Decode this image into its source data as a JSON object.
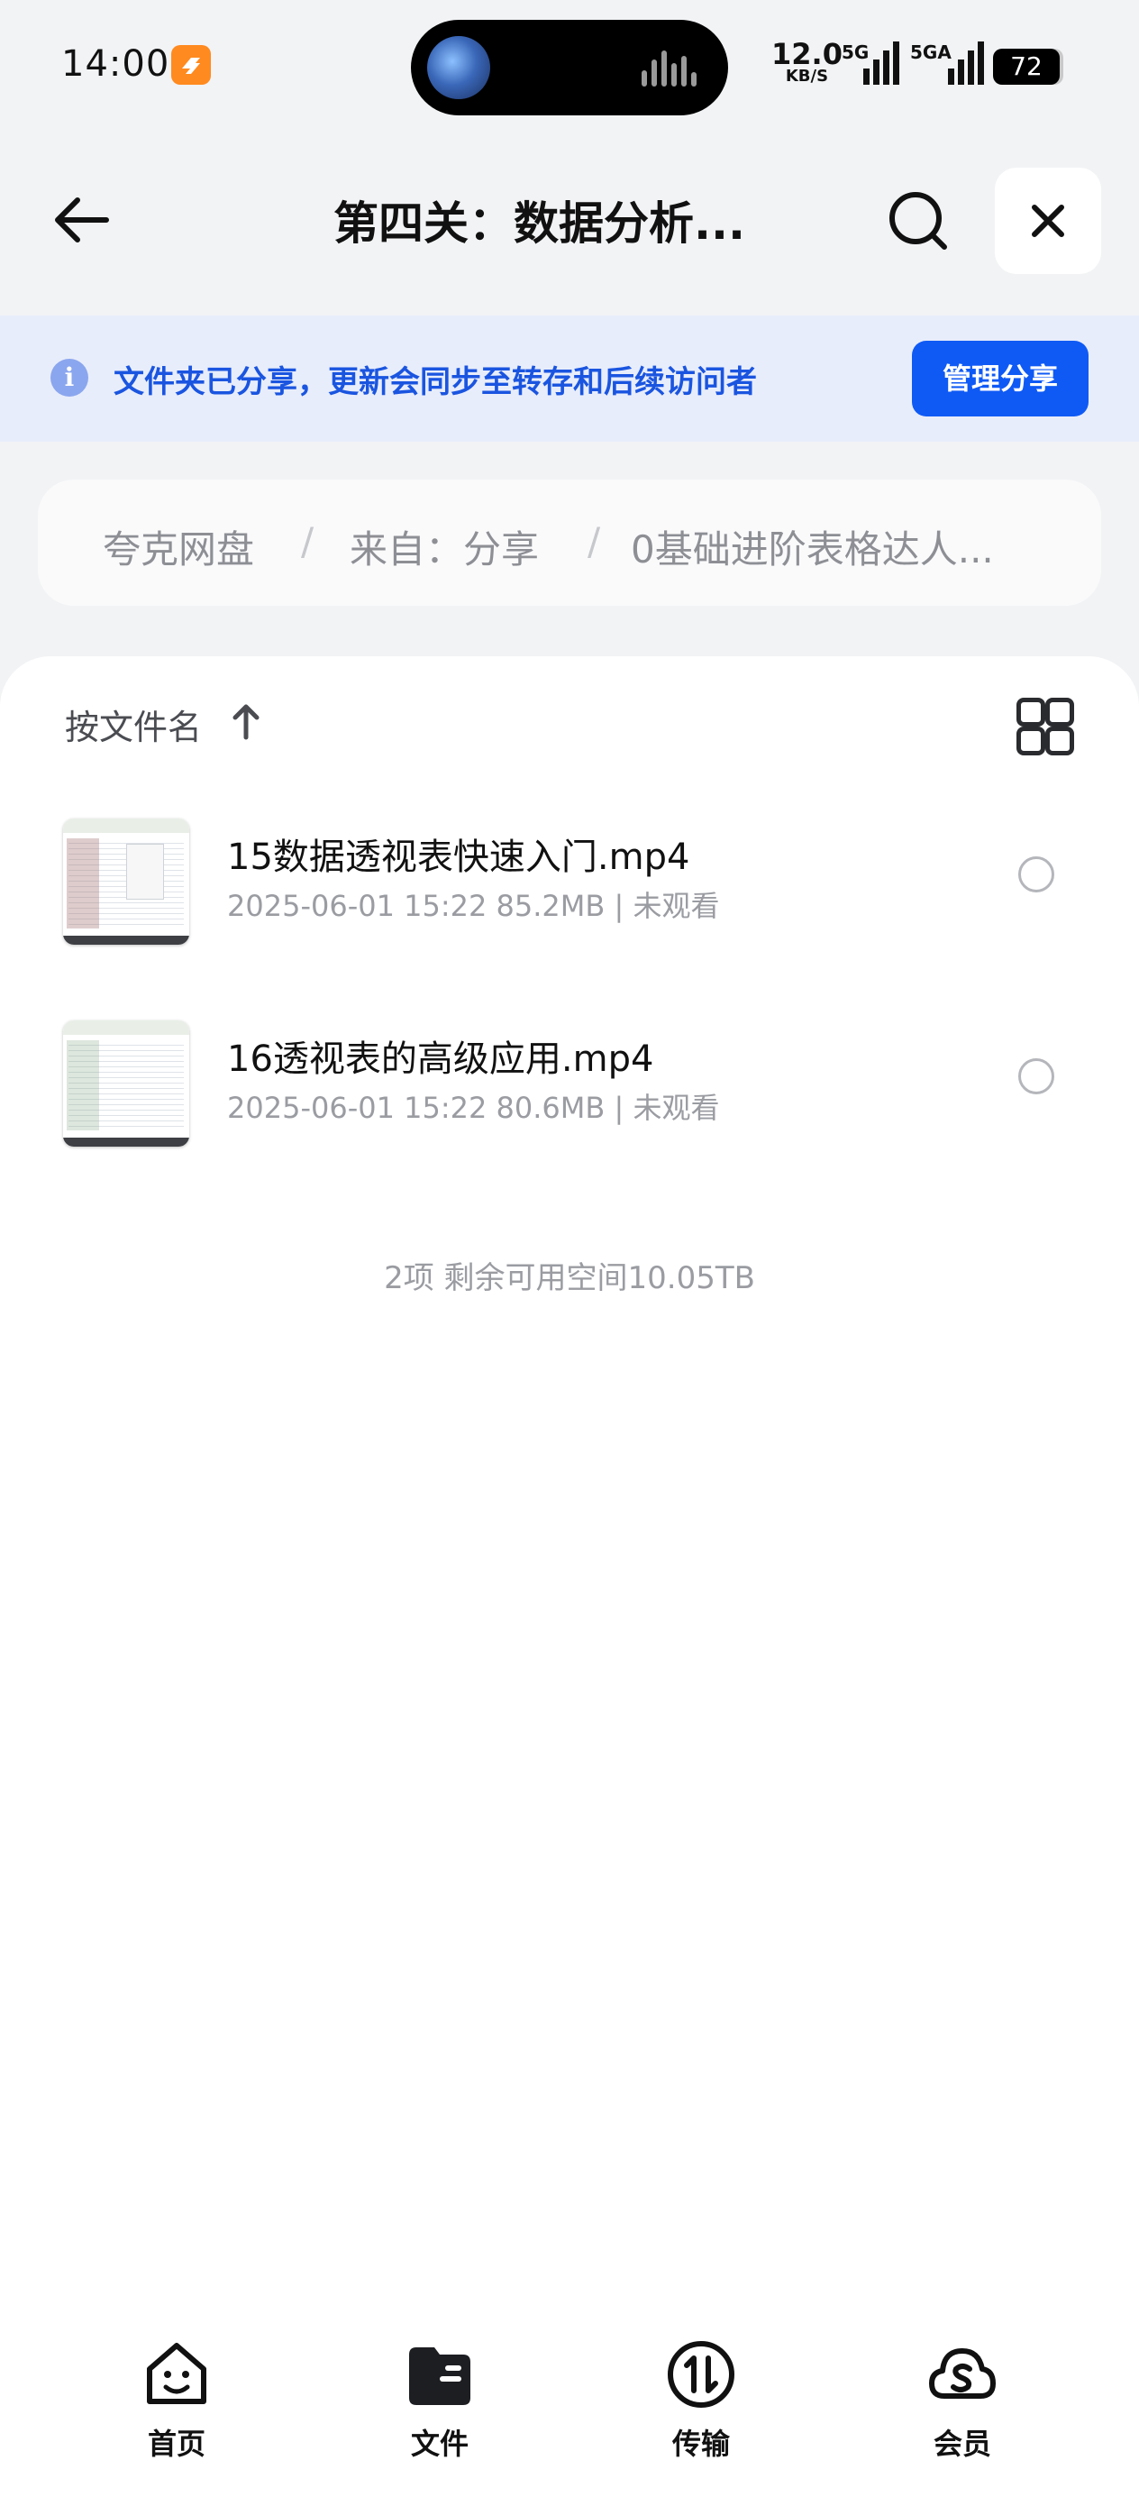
{
  "status_bar": {
    "time": "14:00",
    "net_speed_value": "12.0",
    "net_speed_unit": "KB/S",
    "signal_1_label": "5G",
    "signal_2_label": "5GA",
    "battery": "72",
    "icons": [
      "app-notification-icon",
      "avatar-icon",
      "audio-wave-icon",
      "signal-icon",
      "battery-icon"
    ]
  },
  "header": {
    "title": "第四关：数据分析...",
    "back_icon": "back-arrow-icon",
    "search_icon": "search-icon",
    "close_icon": "close-icon"
  },
  "share_banner": {
    "message": "文件夹已分享，更新会同步至转存和后续访问者",
    "action_label": "管理分享",
    "info_glyph": "i",
    "accent": "#0f5af5"
  },
  "breadcrumb": {
    "items": [
      "夸克网盘",
      "来自：分享",
      "0基础进阶表格达人..."
    ],
    "separator": "/"
  },
  "list": {
    "sort_label": "按文件名",
    "files": [
      {
        "name": "15数据透视表快速入门.mp4",
        "meta": "2025-06-01 15:22  85.2MB | 未观看"
      },
      {
        "name": "16透视表的高级应用.mp4",
        "meta": "2025-06-01 15:22  80.6MB | 未观看"
      }
    ],
    "summary": "2项 剩余可用空间10.05TB"
  },
  "tabbar": {
    "tabs": [
      {
        "label": "首页",
        "icon": "home-smile-icon"
      },
      {
        "label": "文件",
        "icon": "folder-icon"
      },
      {
        "label": "传输",
        "icon": "transfer-icon"
      },
      {
        "label": "会员",
        "icon": "member-cloud-icon"
      }
    ]
  }
}
